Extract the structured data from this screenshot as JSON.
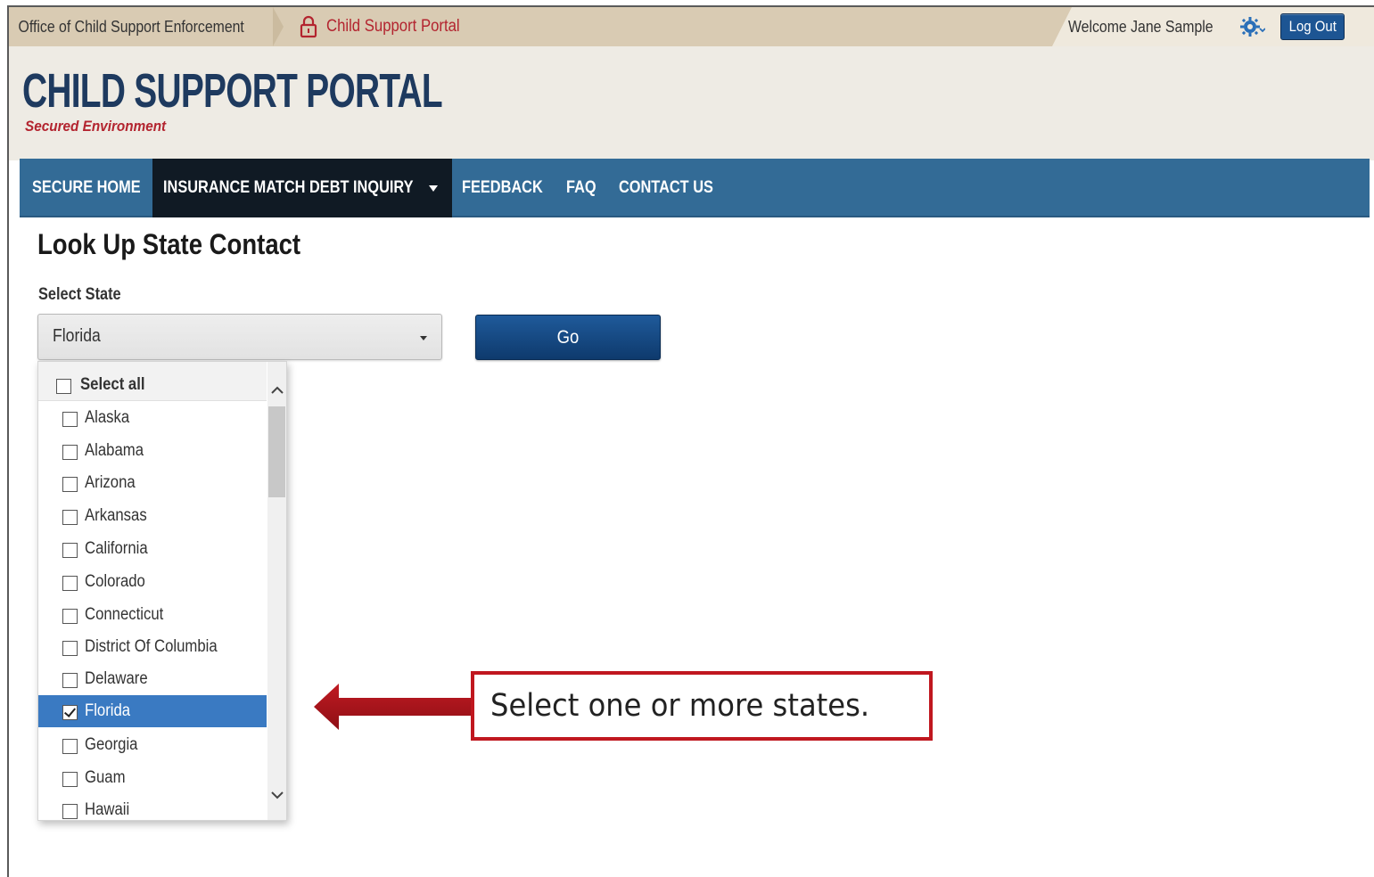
{
  "topbar": {
    "office_label": "Office of Child Support Enforcement",
    "portal_label": "Child Support Portal",
    "welcome_text": "Welcome Jane Sample",
    "logout_label": "Log Out"
  },
  "header": {
    "title": "CHILD SUPPORT PORTAL",
    "subtitle": "Secured Environment"
  },
  "nav": {
    "items": [
      {
        "label": "SECURE HOME"
      },
      {
        "label": "INSURANCE MATCH DEBT INQUIRY"
      },
      {
        "label": "FEEDBACK"
      },
      {
        "label": "FAQ"
      },
      {
        "label": "CONTACT US"
      }
    ],
    "active_index": 1
  },
  "main": {
    "page_title": "Look Up State Contact",
    "select_label": "Select State",
    "select_value": "Florida",
    "go_label": "Go"
  },
  "dropdown": {
    "select_all_label": "Select all",
    "options": [
      {
        "label": "Alaska",
        "checked": false
      },
      {
        "label": "Alabama",
        "checked": false
      },
      {
        "label": "Arizona",
        "checked": false
      },
      {
        "label": "Arkansas",
        "checked": false
      },
      {
        "label": "California",
        "checked": false
      },
      {
        "label": "Colorado",
        "checked": false
      },
      {
        "label": "Connecticut",
        "checked": false
      },
      {
        "label": "District Of Columbia",
        "checked": false
      },
      {
        "label": "Delaware",
        "checked": false
      },
      {
        "label": "Florida",
        "checked": true
      },
      {
        "label": "Georgia",
        "checked": false
      },
      {
        "label": "Guam",
        "checked": false
      },
      {
        "label": "Hawaii",
        "checked": false
      }
    ]
  },
  "annotation": {
    "callout_text": "Select one or more states."
  },
  "colors": {
    "nav_bg": "#336b96",
    "nav_active_bg": "#101a24",
    "brand_navy": "#1e3a5f",
    "brand_red": "#b3242f",
    "selected_row": "#3a7ac2",
    "callout_red": "#c0171f"
  },
  "icons": [
    "lock-icon",
    "gear-icon",
    "chevron-down-icon",
    "chevron-up-icon",
    "checkbox-icon",
    "arrow-left-icon"
  ]
}
